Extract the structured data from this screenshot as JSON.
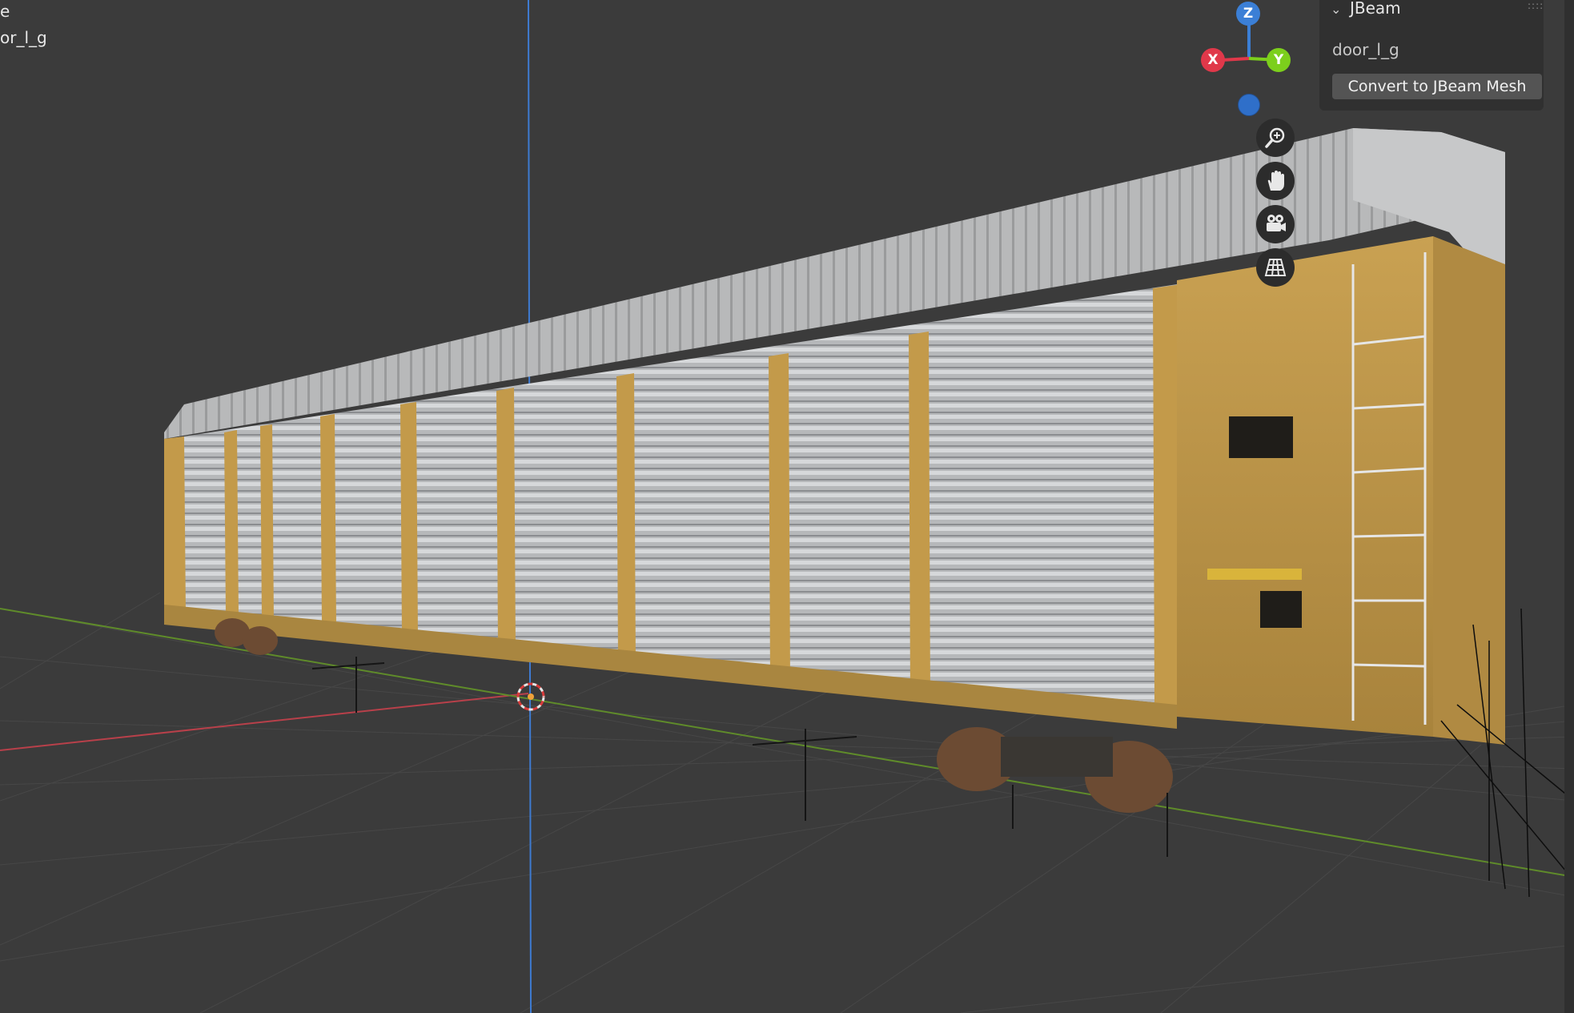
{
  "viewport": {
    "overlay_line1": "e",
    "overlay_line2": "or_l_g"
  },
  "gizmo": {
    "z_label": "Z",
    "x_label": "X",
    "y_label": "Y"
  },
  "nav": {
    "zoom_icon": "zoom-icon",
    "pan_icon": "hand-icon",
    "camera_icon": "camera-icon",
    "ortho_icon": "grid-icon"
  },
  "panel": {
    "title": "JBeam",
    "object_name": "door_l_g",
    "convert_label": "Convert to JBeam Mesh"
  },
  "colors": {
    "axis_x": "#e0384a",
    "axis_y": "#7ccf1c",
    "axis_z": "#3b7fd6",
    "car_body": "#c39a4a",
    "roof": "#bfc0c0",
    "background": "#3b3b3b"
  }
}
